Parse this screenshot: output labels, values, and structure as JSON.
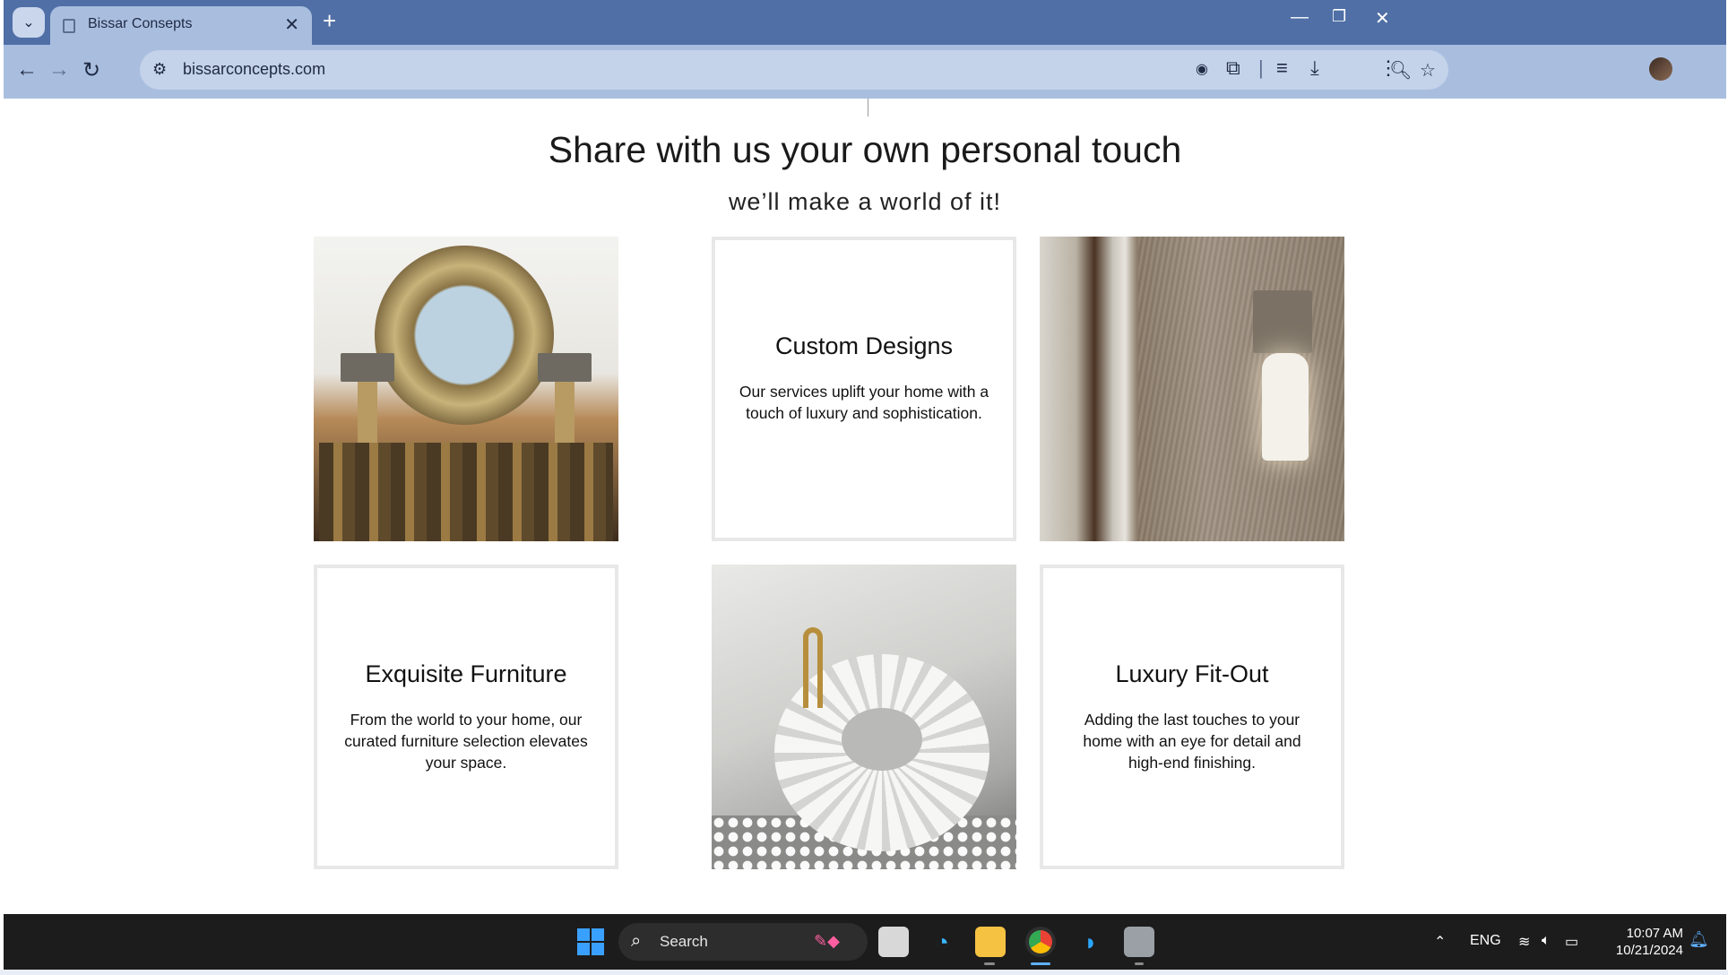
{
  "browser": {
    "tab_title": "Bissar Consepts",
    "url": "bissarconcepts.com",
    "window_controls": [
      "minimize-icon",
      "restore-icon",
      "close-icon"
    ]
  },
  "page": {
    "heading": "Share with us your own personal touch",
    "subheading": "we’ll make a world of it!",
    "cards": [
      {
        "kind": "image",
        "alt": "mirror-console-photo"
      },
      {
        "kind": "text",
        "title": "Custom Designs",
        "desc": "Our services uplift your home with a touch of luxury and sophistication."
      },
      {
        "kind": "image",
        "alt": "wall-sconce-photo"
      },
      {
        "kind": "text",
        "title": "Exquisite Furniture",
        "desc": "From the world to your home, our curated furniture selection elevates your space."
      },
      {
        "kind": "image",
        "alt": "marble-sink-photo"
      },
      {
        "kind": "text",
        "title": "Luxury Fit-Out",
        "desc": "Adding the last touches to your home with an eye for detail and high-end finishing."
      }
    ]
  },
  "taskbar": {
    "search_label": "Search",
    "lang": "ENG",
    "time": "10:07 AM",
    "date": "10/21/2024"
  },
  "colors": {
    "tabstrip": "#4f6fa6",
    "toolbar": "#a9bedf",
    "taskbar": "#1c1c1c",
    "accent": "#3aa0ff"
  }
}
